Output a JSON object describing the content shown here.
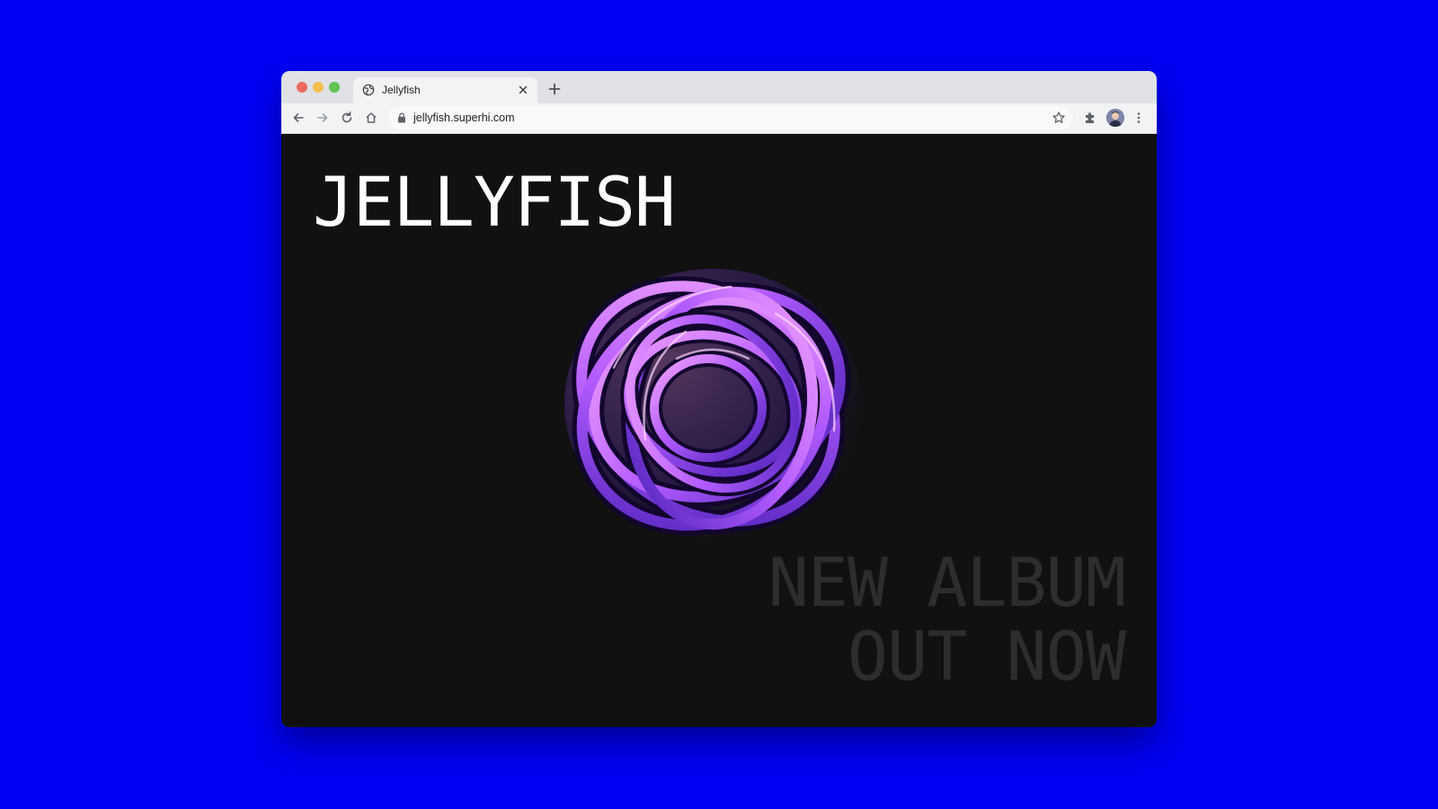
{
  "browser": {
    "tab": {
      "title": "Jellyfish",
      "favicon": "globe-icon"
    },
    "address_bar": {
      "url": "jellyfish.superhi.com",
      "secure_icon": "lock-icon"
    },
    "toolbar_icons": [
      "back-icon",
      "forward-icon",
      "reload-icon",
      "home-icon",
      "bookmark-star-icon",
      "extensions-icon",
      "profile-avatar",
      "menu-kebab-icon"
    ]
  },
  "page": {
    "brand": "JELLYFISH",
    "headline_line1": "NEW ALBUM",
    "headline_line2": "OUT NOW",
    "colors": {
      "background": "#111111",
      "brand_text": "#ffffff",
      "headline_text": "#2d2d2d",
      "art_accent": "#c86bff"
    }
  },
  "desktop": {
    "background_color": "#0000f5"
  }
}
